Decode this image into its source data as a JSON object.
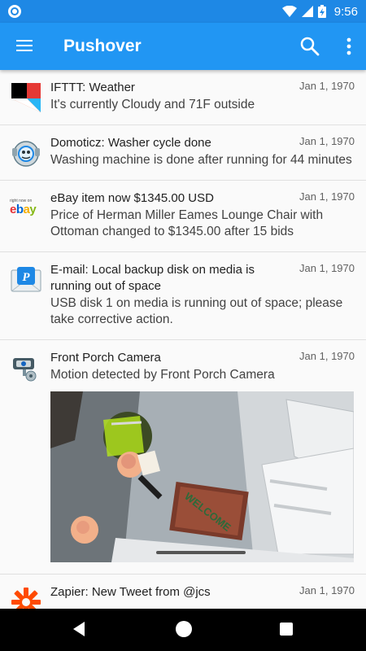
{
  "status_bar": {
    "time": "9:56"
  },
  "app_bar": {
    "title": "Pushover"
  },
  "messages": [
    {
      "title": "IFTTT: Weather",
      "date": "Jan 1, 1970",
      "body": "It's currently Cloudy and 71F outside",
      "icon": "ifttt-icon"
    },
    {
      "title": "Domoticz: Washer cycle done",
      "date": "Jan 1, 1970",
      "body": "Washing machine is done after running for 44 minutes",
      "icon": "domoticz-icon"
    },
    {
      "title": "eBay item now $1345.00 USD",
      "date": "Jan 1, 1970",
      "body": "Price of Herman Miller Eames Lounge Chair with Ottoman changed to $1345.00 after 15 bids",
      "icon": "ebay-icon",
      "icon_caption": "right now on",
      "icon_brand": "ebay"
    },
    {
      "title": "E-mail: Local backup disk on media is running out of space",
      "date": "Jan 1, 1970",
      "body": "USB disk 1 on media is running out of space; please take corrective action.",
      "icon": "email-icon"
    },
    {
      "title": "Front Porch Camera",
      "date": "Jan 1, 1970",
      "body": "Motion detected by Front Porch Camera",
      "icon": "camera-icon",
      "doormat_text": "WELCOME"
    },
    {
      "title": "Zapier: New Tweet from @jcs",
      "date": "Jan 1, 1970",
      "body": "",
      "icon": "zapier-icon"
    }
  ],
  "colors": {
    "status_bar": "#1e88e5",
    "app_bar": "#2196f3",
    "nav_bar": "#000000"
  }
}
